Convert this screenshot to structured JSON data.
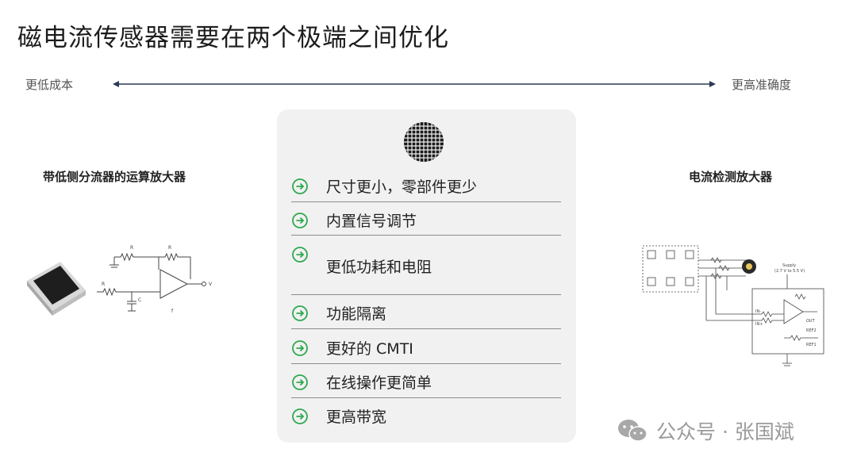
{
  "title": "磁电流传感器需要在两个极端之间优化",
  "axis": {
    "left_label": "更低成本",
    "right_label": "更高准确度"
  },
  "left": {
    "heading": "带低侧分流器的运算放大器",
    "schematic_labels": [
      "R",
      "R",
      "R",
      "C",
      "V",
      "f"
    ]
  },
  "right": {
    "heading": "电流检测放大器",
    "schematic_labels": [
      "Supply",
      "(2.7 V to 5.5 V)",
      "IN-",
      "IN+",
      "OUT",
      "REF2",
      "REF1"
    ]
  },
  "features": [
    {
      "label": "尺寸更小，零部件更少"
    },
    {
      "label": "内置信号调节"
    },
    {
      "label": "更低功耗和电阻"
    },
    {
      "label": "功能隔离"
    },
    {
      "label": "更好的 CMTI"
    },
    {
      "label": "在线操作更简单"
    },
    {
      "label": "更高带宽"
    }
  ],
  "colors": {
    "accent_green": "#2ea84f",
    "panel_bg": "#f1f1f1",
    "title": "#1c1c1c"
  },
  "icons": {
    "chip": "chip-icon",
    "check": "check-circle-icon",
    "wechat": "wechat-icon"
  },
  "watermark": {
    "text": "公众号 · 张国斌"
  }
}
